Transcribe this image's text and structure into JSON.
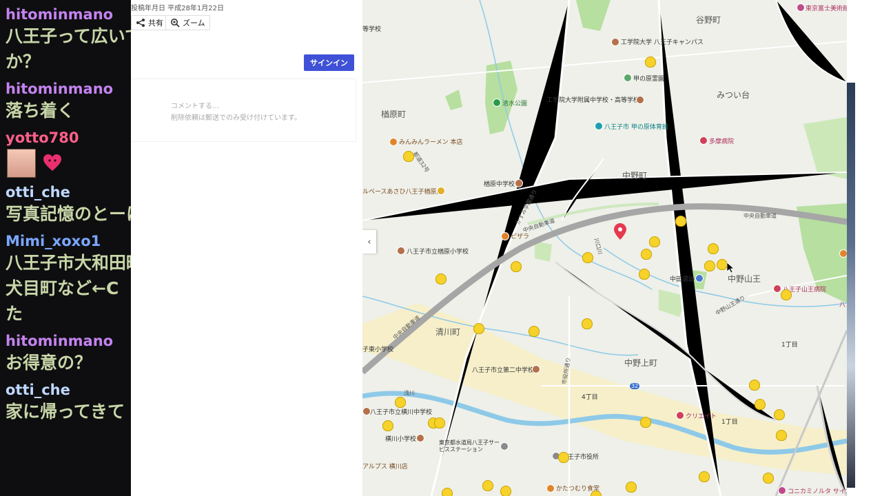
{
  "chat": {
    "messages": [
      {
        "user": "hitominmano",
        "color": "#c483f0",
        "lines": [
          "八王子って広いです",
          "か？"
        ]
      },
      {
        "user": "hitominmano",
        "color": "#c483f0",
        "lines": [
          "落ち着く"
        ]
      },
      {
        "user": "yotto780",
        "color": "#ff5f8a",
        "emotes": [
          "face-emote",
          "heart-emote"
        ]
      },
      {
        "user": "otti_che",
        "color": "#bfd8ff",
        "lines": [
          "写真記憶のとーにかく"
        ]
      },
      {
        "user": "Mimi_xoxo1",
        "color": "#7aa7ff",
        "lines": [
          "八王子市大和田町",
          "犬目町など←C",
          "た"
        ]
      },
      {
        "user": "hitominmano",
        "color": "#c483f0",
        "lines": [
          "お得意の？"
        ]
      },
      {
        "user": "otti_che",
        "color": "#bfd8ff",
        "lines": [
          "家に帰ってきて"
        ]
      }
    ]
  },
  "panel": {
    "post_date": "投稿年月日 平成28年1月22日",
    "share_label": "共有",
    "zoom_label": "ズーム",
    "signin_label": "サインイン",
    "comment_placeholder": "コメントする…",
    "comment_note": "削除依頼は郵送でのみ受け付けています。"
  },
  "map": {
    "areas": [
      "谷野町",
      "楢原町",
      "中野町",
      "みつい台",
      "清川町",
      "中野山王",
      "中野上町",
      "1丁目",
      "4丁目",
      "1丁目"
    ],
    "pois": {
      "school_top": "等学校",
      "kogakuin": "工学院大学 八王子キャンパス",
      "kabuto": "甲の原霊園",
      "shimizu_park": "清水公園",
      "kogakuin_hs": "工学院大学附属中学校・高等学校",
      "gym": "八王子市 甲の原体育館",
      "tama_hospital": "多摩病院",
      "ramen": "みんみんラーメン 本店",
      "narahara_jhs": "楢原中学校",
      "bowling": "ルベースあさひ八王子楢原店",
      "pizzala": "ピザラ",
      "narahara_es": "八王子市立楢原小学校",
      "nakata_ruins": "中田遺跡",
      "sanno_hospital": "八王子山王病院",
      "kiyokawa_es": "子東小学校",
      "daini_jhs": "八王子市立第二中学校",
      "yokokawa_jhs": "八王子市立横川中学校",
      "yokokawa_es": "横川小学校",
      "water_station": "東京都水道局八王子サービスステーション",
      "city_hall": "八王子市役所",
      "alps": "アルプス 横川店",
      "katatsumuri": "かたつむり食堂",
      "create": "クリエイト",
      "fuji_museum": "東京富士美術館",
      "konica": "コニカミノルタ サイエンス",
      "ha": "八"
    },
    "roads": {
      "chuo_expressway_1": "中央自動車道",
      "chuo_expressway_2": "中央自動車道",
      "chuo_expressway_3": "中央自動車道",
      "route32": "都道32号",
      "kasumi": "かすみ学園通り",
      "river": "川口川",
      "nakanoyama": "中野山王通り",
      "shiyakusho": "市役所通り",
      "route": "32",
      "asakawa": "浅川"
    }
  },
  "colors": {
    "chat_bg": "#0e0e10",
    "chat_text": "#c8d6a8",
    "signin": "#3f51d6",
    "expressway": "#a6a6a6",
    "park": "#b7dfa0",
    "water": "#8ec9e8",
    "red_pin": "#e53950"
  }
}
